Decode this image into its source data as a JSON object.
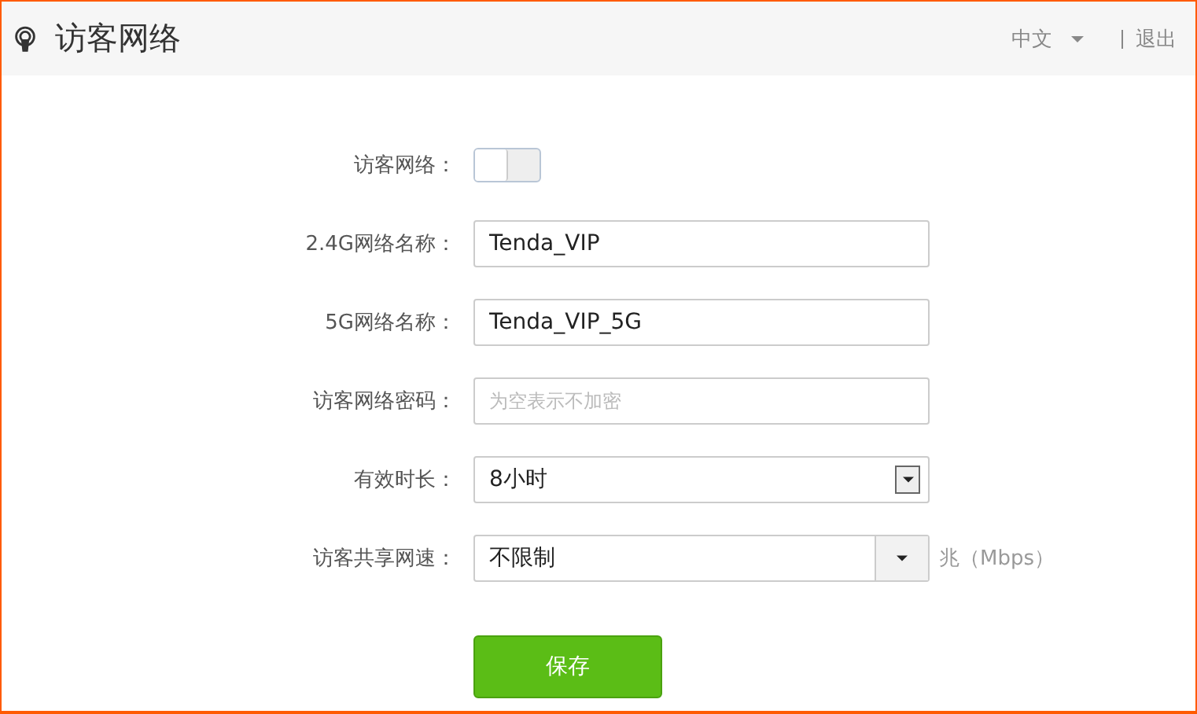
{
  "header": {
    "title": "访客网络",
    "language": "中文",
    "logout": "退出"
  },
  "fields": [
    {
      "kind": "toggle",
      "label": "访客网络：",
      "on": false
    },
    {
      "kind": "text",
      "label": "2.4G网络名称：",
      "value": "Tenda_VIP"
    },
    {
      "kind": "text",
      "label": "5G网络名称：",
      "value": "Tenda_VIP_5G"
    },
    {
      "kind": "text",
      "label": "访客网络密码：",
      "placeholder": "为空表示不加密"
    },
    {
      "kind": "select",
      "label": "有效时长：",
      "value": "8小时"
    },
    {
      "kind": "combo",
      "label": "访客共享网速：",
      "value": "不限制",
      "unit": "兆（Mbps）"
    }
  ],
  "save_button": "保存"
}
